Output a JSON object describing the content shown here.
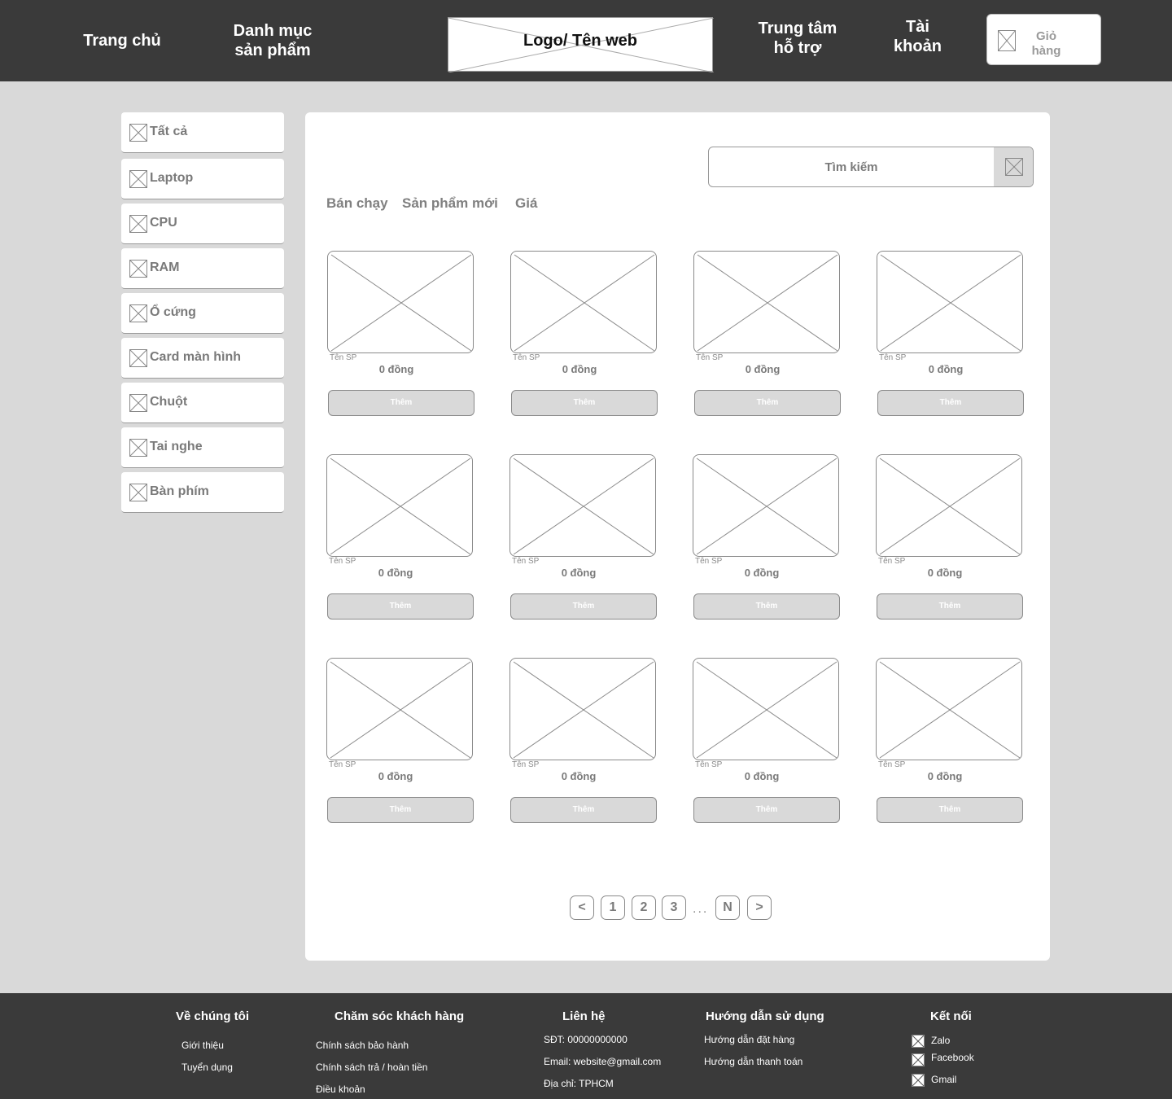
{
  "header": {
    "nav": {
      "home": "Trang chủ",
      "categories": "Danh mục\nsản phẩm",
      "support": "Trung tâm\nhỗ trợ",
      "account": "Tài\nkhoản"
    },
    "logo": "Logo/ Tên web",
    "cart": "Giỏ\nhàng"
  },
  "sidebar": {
    "items": [
      {
        "label": "Tất cả"
      },
      {
        "label": "Laptop"
      },
      {
        "label": "CPU"
      },
      {
        "label": "RAM"
      },
      {
        "label": "Ổ cứng"
      },
      {
        "label": "Card màn hình"
      },
      {
        "label": "Chuột"
      },
      {
        "label": "Tai nghe"
      },
      {
        "label": "Bàn phím"
      }
    ]
  },
  "main": {
    "search": {
      "placeholder": "Tìm kiếm"
    },
    "sort_tabs": [
      "Bán chạy",
      "Sản phẩm mới",
      "Giá"
    ],
    "product_name": "Tên SP",
    "product_price": "0 đồng",
    "add_label": "Thêm",
    "pagination": {
      "prev": "<",
      "pages": [
        "1",
        "2",
        "3"
      ],
      "ellipsis": "...",
      "last": "N",
      "next": ">"
    }
  },
  "footer": {
    "about": {
      "title": "Về chúng tôi",
      "links": [
        "Giới thiệu",
        "Tuyển dụng"
      ]
    },
    "care": {
      "title": "Chăm sóc khách hàng",
      "links": [
        "Chính sách bảo hành",
        "Chính sách trả / hoàn tiền",
        "Điều khoản"
      ]
    },
    "contact": {
      "title": "Liên hệ",
      "lines": [
        "SĐT: 00000000000",
        "Email: website@gmail.com",
        "Địa chỉ: TPHCM"
      ]
    },
    "guide": {
      "title": "Hướng dẫn sử dụng",
      "links": [
        "Hướng dẫn đặt hàng",
        "Hướng dẫn thanh toán"
      ]
    },
    "social": {
      "title": "Kết nối",
      "links": [
        "Zalo",
        "Facebook",
        "Gmail"
      ]
    }
  },
  "colors": {
    "header_bg": "#3a3a3a",
    "page_bg": "#d9d9d9",
    "panel_bg": "#ffffff",
    "muted_text": "#7a7a7a"
  }
}
